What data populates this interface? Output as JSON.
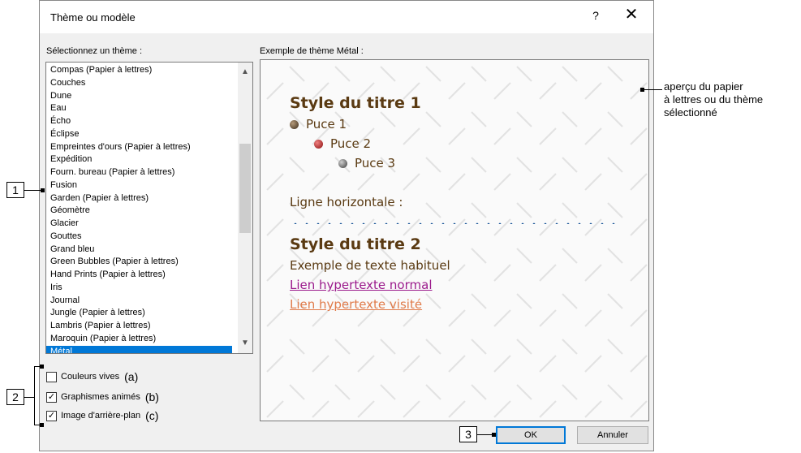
{
  "dialog": {
    "title": "Thème ou modèle",
    "help_label": "?",
    "close_label": "✕"
  },
  "theme_list": {
    "label": "Sélectionnez un thème :",
    "items": [
      "Compas (Papier à lettres)",
      "Couches",
      "Dune",
      "Eau",
      "Écho",
      "Éclipse",
      "Empreintes d'ours (Papier à lettres)",
      "Expédition",
      "Fourn. bureau (Papier à lettres)",
      "Fusion",
      "Garden (Papier à lettres)",
      "Géomètre",
      "Glacier",
      "Gouttes",
      "Grand bleu",
      "Green Bubbles (Papier à lettres)",
      "Hand Prints (Papier à lettres)",
      "Iris",
      "Journal",
      "Jungle (Papier à lettres)",
      "Lambris (Papier à lettres)",
      "Maroquin (Papier à lettres)",
      "Métal"
    ],
    "selected": "Métal",
    "scroll_up_icon": "chevron-up-icon",
    "scroll_down_icon": "chevron-down-icon"
  },
  "options": {
    "vivid_colors": {
      "label": "Couleurs vives",
      "note": "(a)",
      "checked": false
    },
    "animated_graphics": {
      "label": "Graphismes animés",
      "note": "(b)",
      "checked": true
    },
    "background_image": {
      "label": "Image d'arrière-plan",
      "note": "(c)",
      "checked": true
    }
  },
  "preview": {
    "label": "Exemple de thème Métal :",
    "heading1": "Style du titre 1",
    "bullet1": "Puce 1",
    "bullet2": "Puce 2",
    "bullet3": "Puce 3",
    "hr_label": "Ligne horizontale :",
    "heading2": "Style du titre 2",
    "body_text": "Exemple de texte habituel",
    "link_normal": "Lien hypertexte normal",
    "link_visited": "Lien hypertexte visité",
    "colors": {
      "heading": "#5a3a12",
      "link": "#9b1b8c",
      "visited": "#e07b4a"
    }
  },
  "buttons": {
    "ok": "OK",
    "cancel": "Annuler"
  },
  "callouts": {
    "c1": "1",
    "c2": "2",
    "c3": "3",
    "note_line1": "aperçu du papier",
    "note_line2": "à lettres ou du thème",
    "note_line3": "sélectionné"
  }
}
